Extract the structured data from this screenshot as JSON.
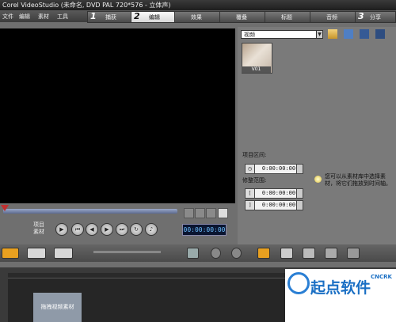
{
  "window": {
    "title": "Corel VideoStudio (未命名, DVD PAL 720*576 - 立体声)"
  },
  "menu": [
    "文件",
    "编辑",
    "素材",
    "工具"
  ],
  "steps": [
    {
      "num": "1",
      "label": "捕获"
    },
    {
      "num": "2",
      "label": "编辑"
    },
    {
      "num": "",
      "label": "效果"
    },
    {
      "num": "",
      "label": "覆叠"
    },
    {
      "num": "",
      "label": "标题"
    },
    {
      "num": "",
      "label": "音频"
    },
    {
      "num": "3",
      "label": "分享"
    }
  ],
  "player": {
    "project_label": "项目",
    "clip_label": "素材",
    "timecode": "00:00:00:00",
    "buttons": [
      "play-icon",
      "go-start-icon",
      "prev-frame-icon",
      "next-frame-icon",
      "go-end-icon",
      "repeat-icon",
      "volume-icon"
    ]
  },
  "library": {
    "category": "视频",
    "clip_label": "V01"
  },
  "options": {
    "project_range_label": "项目区间:",
    "project_duration": "0:00:00:00",
    "trim_range_label": "修整范围:",
    "trim_in": "0:00:00:00",
    "trim_out": "0:00:00:00",
    "hint": "您可以从素材库中选择素材，将它们拖放到时间轴。"
  },
  "timeline": {
    "drop_hint": "拖拽视频素材"
  },
  "watermark": {
    "brand": "起点软件",
    "latin": "CNCRK"
  },
  "colors": {
    "accent_orange": "#e8a020",
    "timecode_text": "#6ec0ff",
    "brand_blue": "#1a6fc4"
  }
}
